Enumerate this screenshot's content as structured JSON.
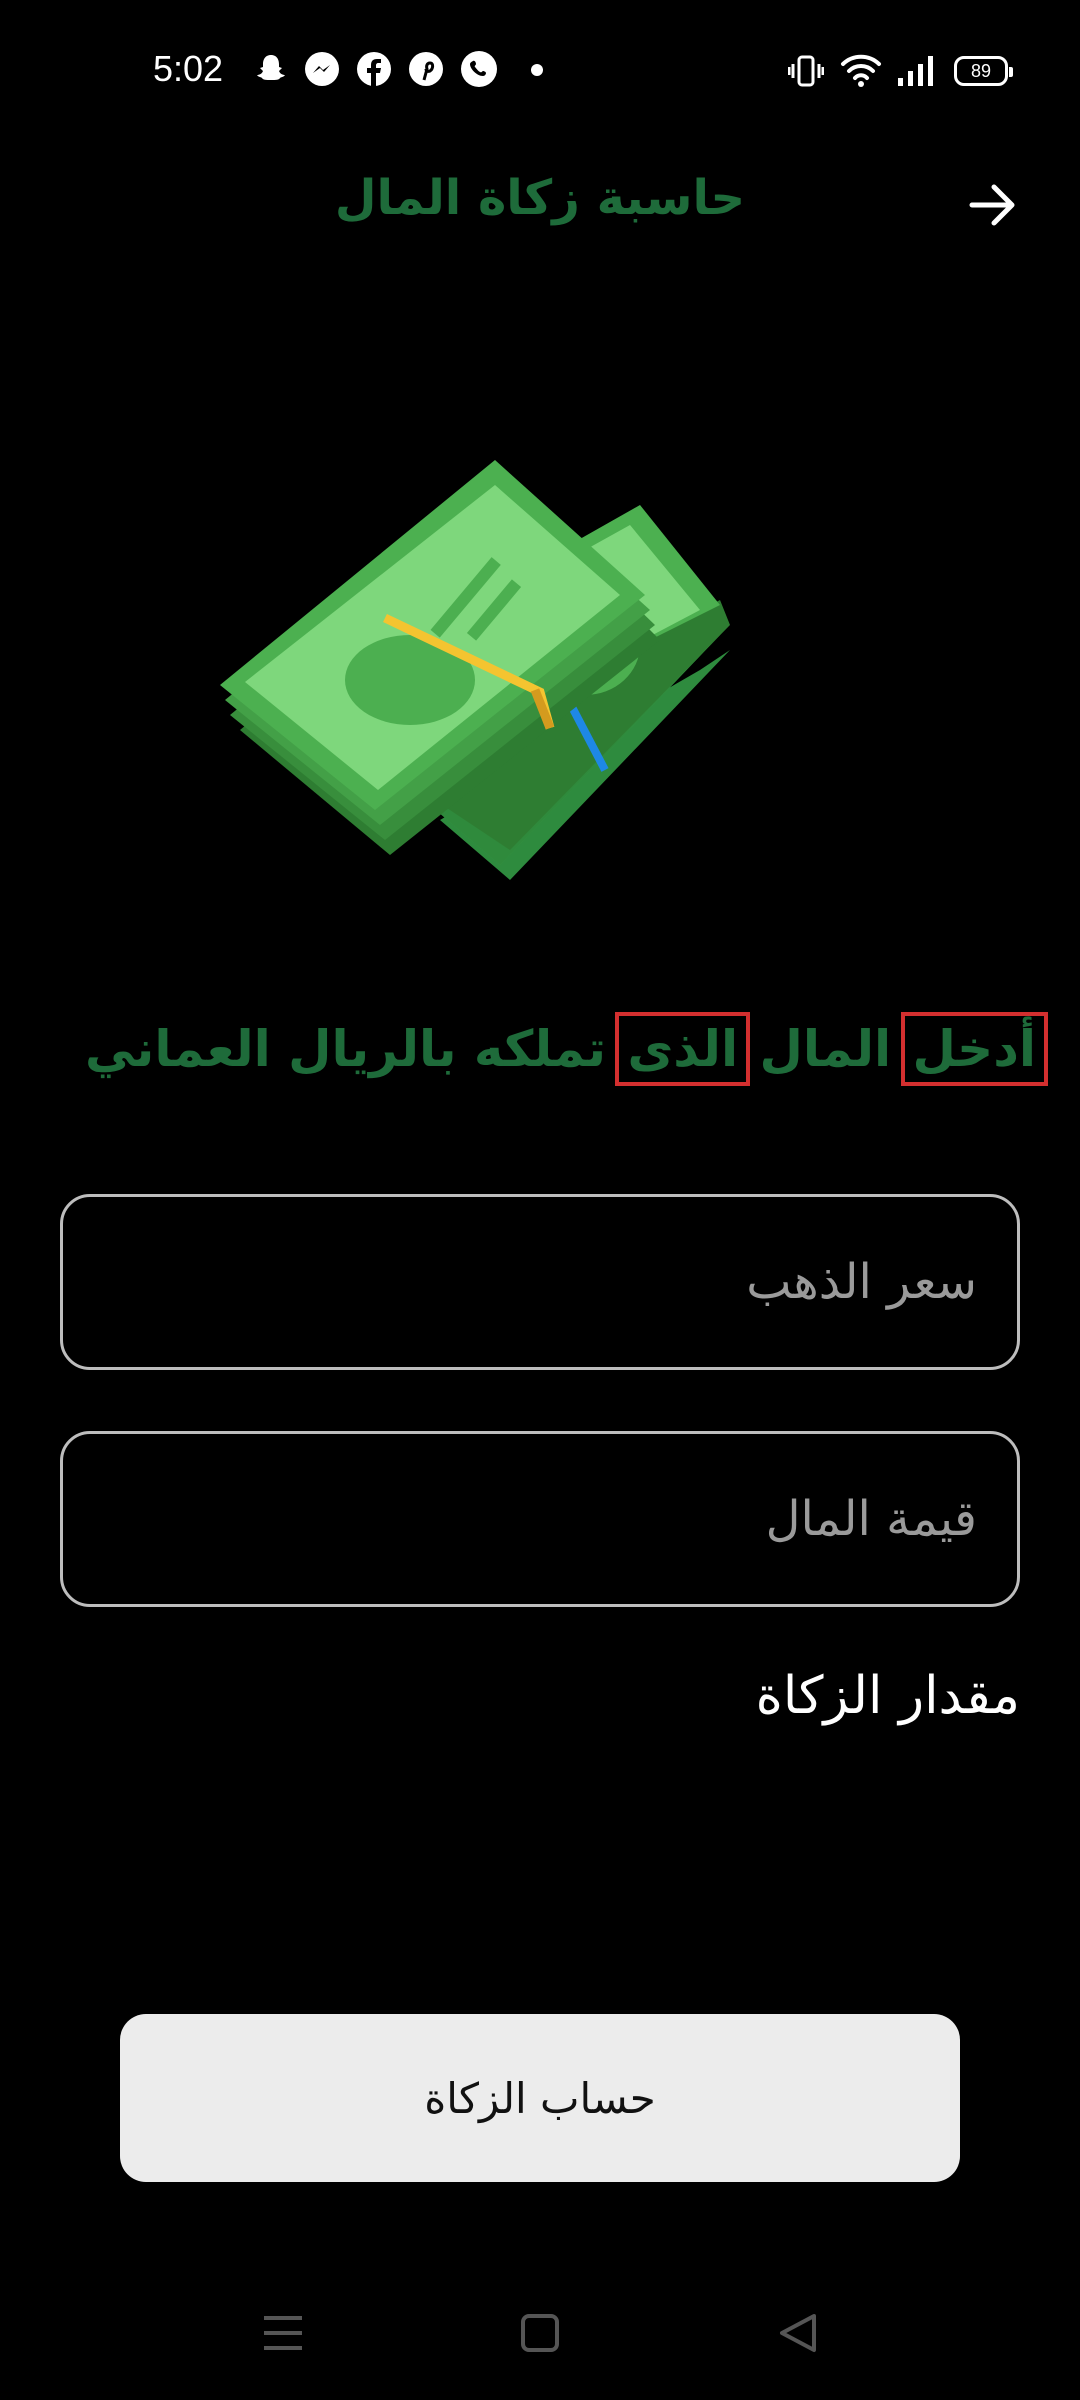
{
  "status_bar": {
    "time": "5:02",
    "battery": "89",
    "notification_icons": [
      "snapchat-icon",
      "messenger-icon",
      "facebook-icon",
      "pinterest-icon",
      "whatsapp-icon"
    ]
  },
  "app_bar": {
    "title": "حاسبة زكاة المال",
    "back_icon": "arrow-right-icon"
  },
  "instruction": {
    "word1": "أدخل",
    "word2": "المال",
    "word3": "الذى",
    "word4": "تملكه بالريال العماني"
  },
  "form": {
    "gold_price_placeholder": "سعر الذهب",
    "money_value_placeholder": "قيمة المال",
    "zakat_amount_label": "مقدار الزكاة",
    "calculate_button": "حساب الزكاة"
  },
  "colors": {
    "title_green": "#1e6b3a",
    "background": "#000000",
    "highlight_box": "#d32f2f",
    "button_bg": "#ececec"
  }
}
